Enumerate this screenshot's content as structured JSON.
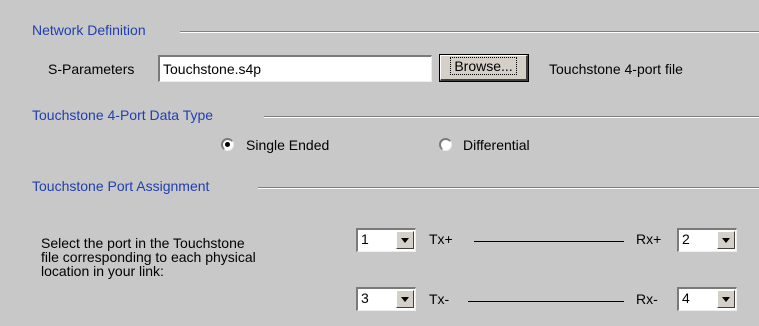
{
  "network_definition": {
    "title": "Network Definition",
    "s_param_label": "S-Parameters",
    "s_param_value": "Touchstone.s4p",
    "browse_label": "Browse...",
    "file_desc": "Touchstone 4-port file"
  },
  "data_type": {
    "title": "Touchstone 4-Port Data Type",
    "options": [
      {
        "label": "Single Ended",
        "checked": true
      },
      {
        "label": "Differential",
        "checked": false
      }
    ]
  },
  "port_assignment": {
    "title": "Touchstone Port Assignment",
    "description_lines": [
      "Select the port in the Touchstone",
      "file corresponding to each physical",
      "location in your link:"
    ],
    "rows": [
      {
        "left_port": "1",
        "tx_label": "Tx+",
        "rx_label": "Rx+",
        "right_port": "2"
      },
      {
        "left_port": "3",
        "tx_label": "Tx-",
        "rx_label": "Rx-",
        "right_port": "4"
      }
    ]
  }
}
